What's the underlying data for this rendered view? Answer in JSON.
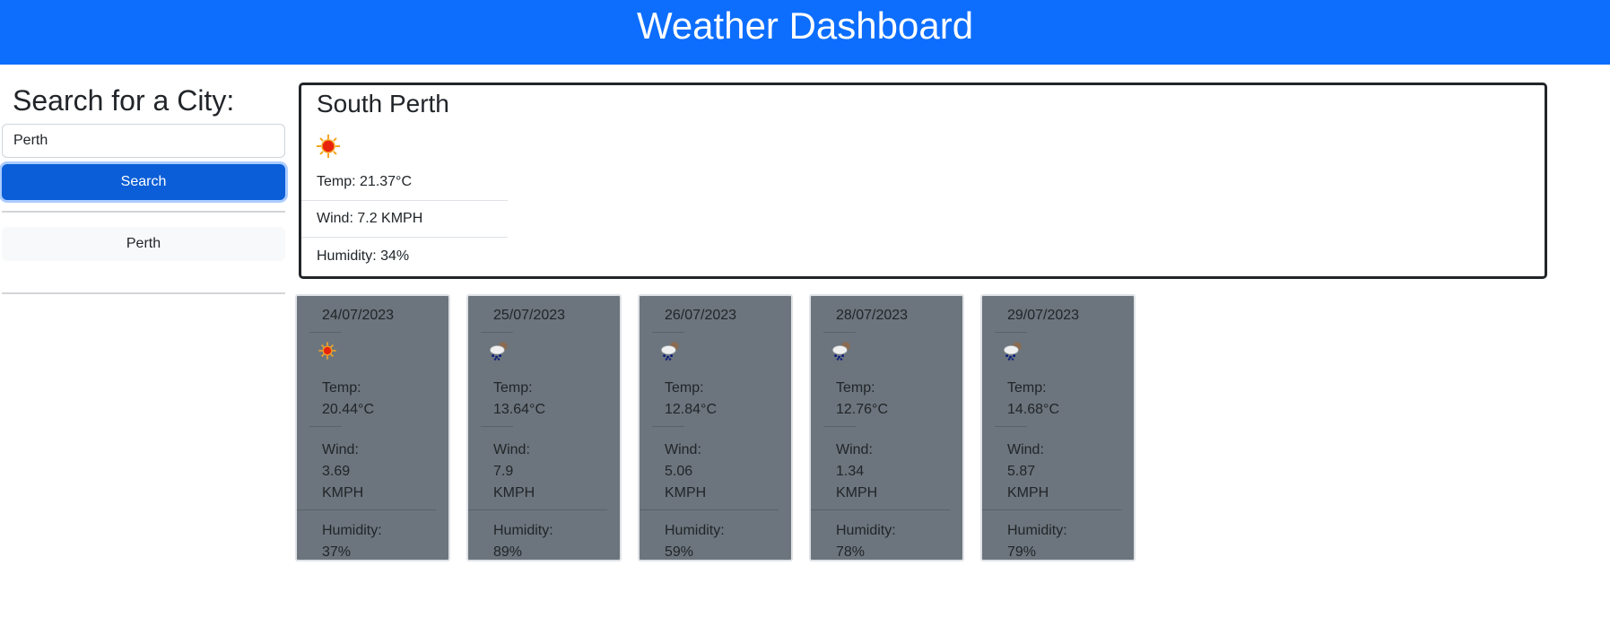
{
  "header": {
    "title": "Weather Dashboard"
  },
  "sidebar": {
    "heading": "Search for a City:",
    "search_value": "Perth",
    "search_button": "Search",
    "history": [
      "Perth"
    ]
  },
  "current": {
    "city": "South Perth",
    "icon": "sun-icon",
    "temp": "Temp: 21.37°C",
    "wind": "Wind: 7.2 KMPH",
    "humidity": "Humidity: 34%"
  },
  "forecast": [
    {
      "date": "24/07/2023",
      "icon": "sun-icon",
      "temp_label": "Temp:",
      "temp": "20.44°C",
      "wind_label": "Wind:",
      "wind": "3.69",
      "wind_unit": "KMPH",
      "humidity_label": "Humidity:",
      "humidity": "37%"
    },
    {
      "date": "25/07/2023",
      "icon": "rain-cloud-icon",
      "temp_label": "Temp:",
      "temp": "13.64°C",
      "wind_label": "Wind:",
      "wind": "7.9",
      "wind_unit": "KMPH",
      "humidity_label": "Humidity:",
      "humidity": "89%"
    },
    {
      "date": "26/07/2023",
      "icon": "rain-cloud-icon",
      "temp_label": "Temp:",
      "temp": "12.84°C",
      "wind_label": "Wind:",
      "wind": "5.06",
      "wind_unit": "KMPH",
      "humidity_label": "Humidity:",
      "humidity": "59%"
    },
    {
      "date": "28/07/2023",
      "icon": "rain-cloud-icon",
      "temp_label": "Temp:",
      "temp": "12.76°C",
      "wind_label": "Wind:",
      "wind": "1.34",
      "wind_unit": "KMPH",
      "humidity_label": "Humidity:",
      "humidity": "78%"
    },
    {
      "date": "29/07/2023",
      "icon": "rain-cloud-icon",
      "temp_label": "Temp:",
      "temp": "14.68°C",
      "wind_label": "Wind:",
      "wind": "5.87",
      "wind_unit": "KMPH",
      "humidity_label": "Humidity:",
      "humidity": "79%"
    }
  ],
  "colors": {
    "header": "#0d6efd",
    "search_button": "#0b5ed7",
    "card_bg": "#6c757d"
  }
}
